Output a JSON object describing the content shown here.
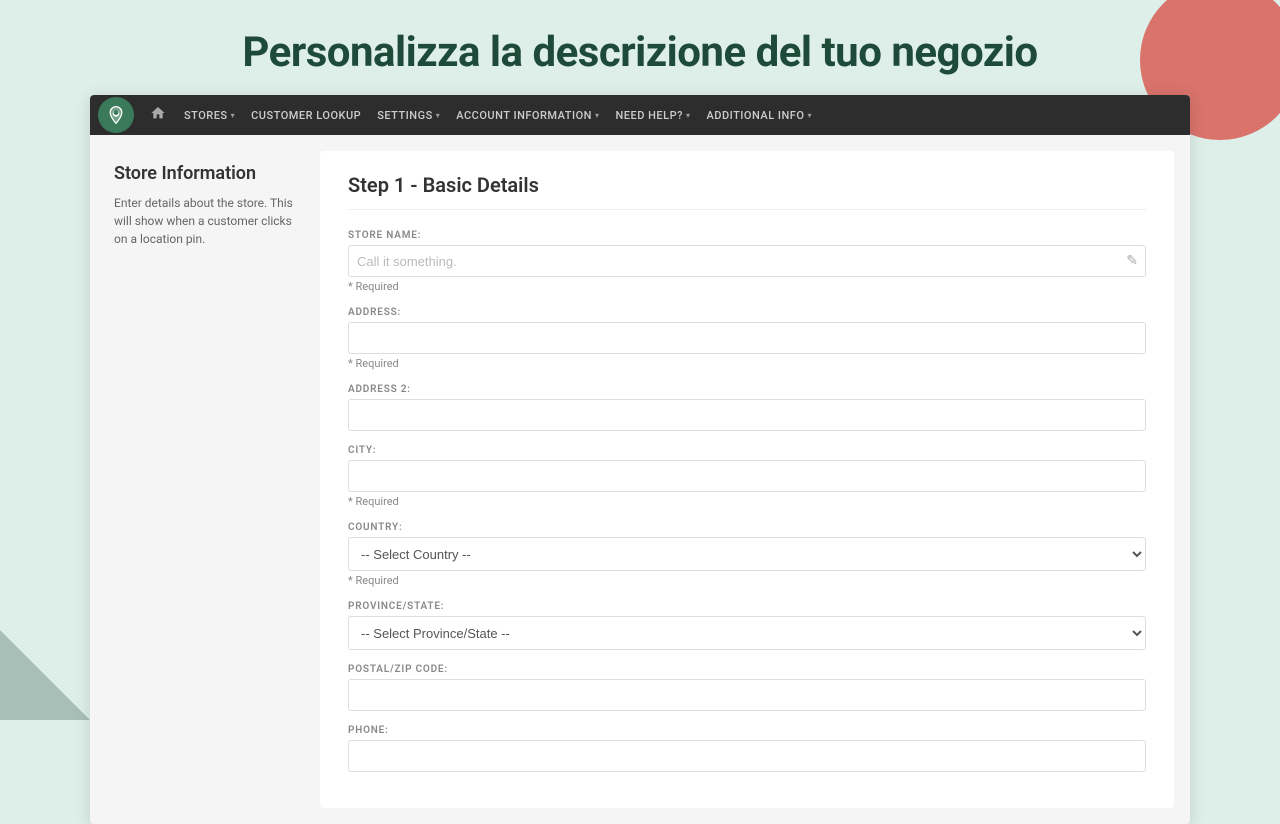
{
  "page": {
    "title": "Personalizza la descrizione del tuo negozio"
  },
  "navbar": {
    "logo_alt": "Store Locator Logo",
    "home_label": "🏠",
    "items": [
      {
        "label": "STORES",
        "has_dropdown": true
      },
      {
        "label": "CUSTOMER LOOKUP",
        "has_dropdown": false
      },
      {
        "label": "SETTINGS",
        "has_dropdown": true
      },
      {
        "label": "ACCOUNT INFORMATION",
        "has_dropdown": true
      },
      {
        "label": "NEED HELP?",
        "has_dropdown": true
      },
      {
        "label": "ADDITIONAL INFO",
        "has_dropdown": true
      }
    ]
  },
  "sidebar": {
    "title": "Store Information",
    "description": "Enter details about the store. This will show when a customer clicks on a location pin."
  },
  "form": {
    "step_title": "Step 1 - Basic Details",
    "fields": {
      "store_name": {
        "label": "STORE NAME:",
        "placeholder": "Call it something.",
        "required_text": "* Required"
      },
      "address": {
        "label": "ADDRESS:",
        "placeholder": "",
        "required_text": "* Required"
      },
      "address2": {
        "label": "ADDRESS 2:",
        "placeholder": ""
      },
      "city": {
        "label": "CITY:",
        "placeholder": "",
        "required_text": "* Required"
      },
      "country": {
        "label": "COUNTRY:",
        "default_option": "-- Select Country --",
        "required_text": "* Required"
      },
      "province_state": {
        "label": "PROVINCE/STATE:",
        "default_option": "-- Select Province/State --"
      },
      "postal_zip": {
        "label": "POSTAL/ZIP CODE:",
        "placeholder": ""
      },
      "phone": {
        "label": "PHONE:",
        "placeholder": ""
      }
    }
  }
}
